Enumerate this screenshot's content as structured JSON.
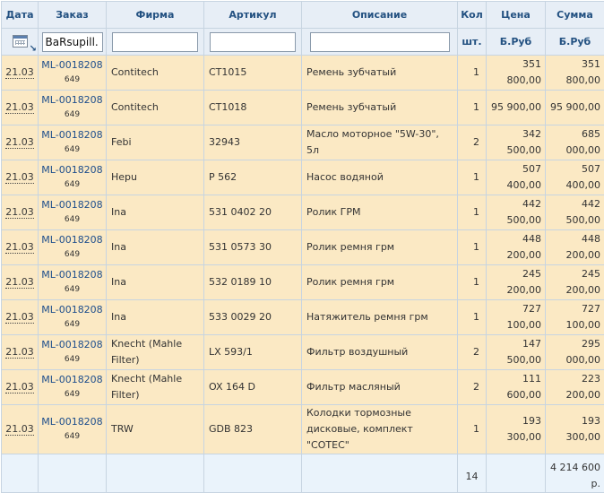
{
  "headers": {
    "date": "Дата",
    "order": "Заказ",
    "brand": "Фирма",
    "article": "Артикул",
    "description": "Описание",
    "qty": "Кол",
    "price": "Цена",
    "sum": "Сумма"
  },
  "filters": {
    "order_value": "BaRsupill.",
    "brand_value": "",
    "article_value": "",
    "description_value": "",
    "qty_unit": "шт.",
    "price_unit": "Б.Руб",
    "sum_unit": "Б.Руб",
    "calendar_icon": "calendar-icon"
  },
  "rows": [
    {
      "date": "21.03",
      "order": "ML-0018208",
      "order_sub": "649",
      "brand": "Contitech",
      "article": "CT1015",
      "description": "Ремень зубчатый",
      "qty": "1",
      "price": "351 800,00",
      "sum": "351 800,00"
    },
    {
      "date": "21.03",
      "order": "ML-0018208",
      "order_sub": "649",
      "brand": "Contitech",
      "article": "CT1018",
      "description": "Ремень зубчатый",
      "qty": "1",
      "price": "95 900,00",
      "sum": "95 900,00"
    },
    {
      "date": "21.03",
      "order": "ML-0018208",
      "order_sub": "649",
      "brand": "Febi",
      "article": "32943",
      "description": "Масло моторное \"5W-30\", 5л",
      "qty": "2",
      "price": "342 500,00",
      "sum": "685 000,00"
    },
    {
      "date": "21.03",
      "order": "ML-0018208",
      "order_sub": "649",
      "brand": "Hepu",
      "article": "P 562",
      "description": "Насос водяной",
      "qty": "1",
      "price": "507 400,00",
      "sum": "507 400,00"
    },
    {
      "date": "21.03",
      "order": "ML-0018208",
      "order_sub": "649",
      "brand": "Ina",
      "article": "531 0402 20",
      "description": "Ролик ГРМ",
      "qty": "1",
      "price": "442 500,00",
      "sum": "442 500,00"
    },
    {
      "date": "21.03",
      "order": "ML-0018208",
      "order_sub": "649",
      "brand": "Ina",
      "article": "531 0573 30",
      "description": "Ролик ремня грм",
      "qty": "1",
      "price": "448 200,00",
      "sum": "448 200,00"
    },
    {
      "date": "21.03",
      "order": "ML-0018208",
      "order_sub": "649",
      "brand": "Ina",
      "article": "532 0189 10",
      "description": "Ролик ремня грм",
      "qty": "1",
      "price": "245 200,00",
      "sum": "245 200,00"
    },
    {
      "date": "21.03",
      "order": "ML-0018208",
      "order_sub": "649",
      "brand": "Ina",
      "article": "533 0029 20",
      "description": "Натяжитель ремня грм",
      "qty": "1",
      "price": "727 100,00",
      "sum": "727 100,00"
    },
    {
      "date": "21.03",
      "order": "ML-0018208",
      "order_sub": "649",
      "brand": "Knecht (Mahle Filter)",
      "article": "LX 593/1",
      "description": "Фильтр воздушный",
      "qty": "2",
      "price": "147 500,00",
      "sum": "295 000,00"
    },
    {
      "date": "21.03",
      "order": "ML-0018208",
      "order_sub": "649",
      "brand": "Knecht (Mahle Filter)",
      "article": "OX 164 D",
      "description": "Фильтр масляный",
      "qty": "2",
      "price": "111 600,00",
      "sum": "223 200,00"
    },
    {
      "date": "21.03",
      "order": "ML-0018208",
      "order_sub": "649",
      "brand": "TRW",
      "article": "GDB 823",
      "description": "Колодки тормозные дисковые, комплект \"COTEC\"",
      "qty": "1",
      "price": "193 300,00",
      "sum": "193 300,00"
    }
  ],
  "totals": {
    "qty": "14",
    "sum": "4 214 600 р."
  },
  "colors": {
    "header_bg": "#e7eef6",
    "header_text": "#235181",
    "row_bg": "#fbe9c4",
    "footer_bg": "#eaf3fb",
    "border": "#c7d4e1",
    "link": "#1e4e8c"
  }
}
